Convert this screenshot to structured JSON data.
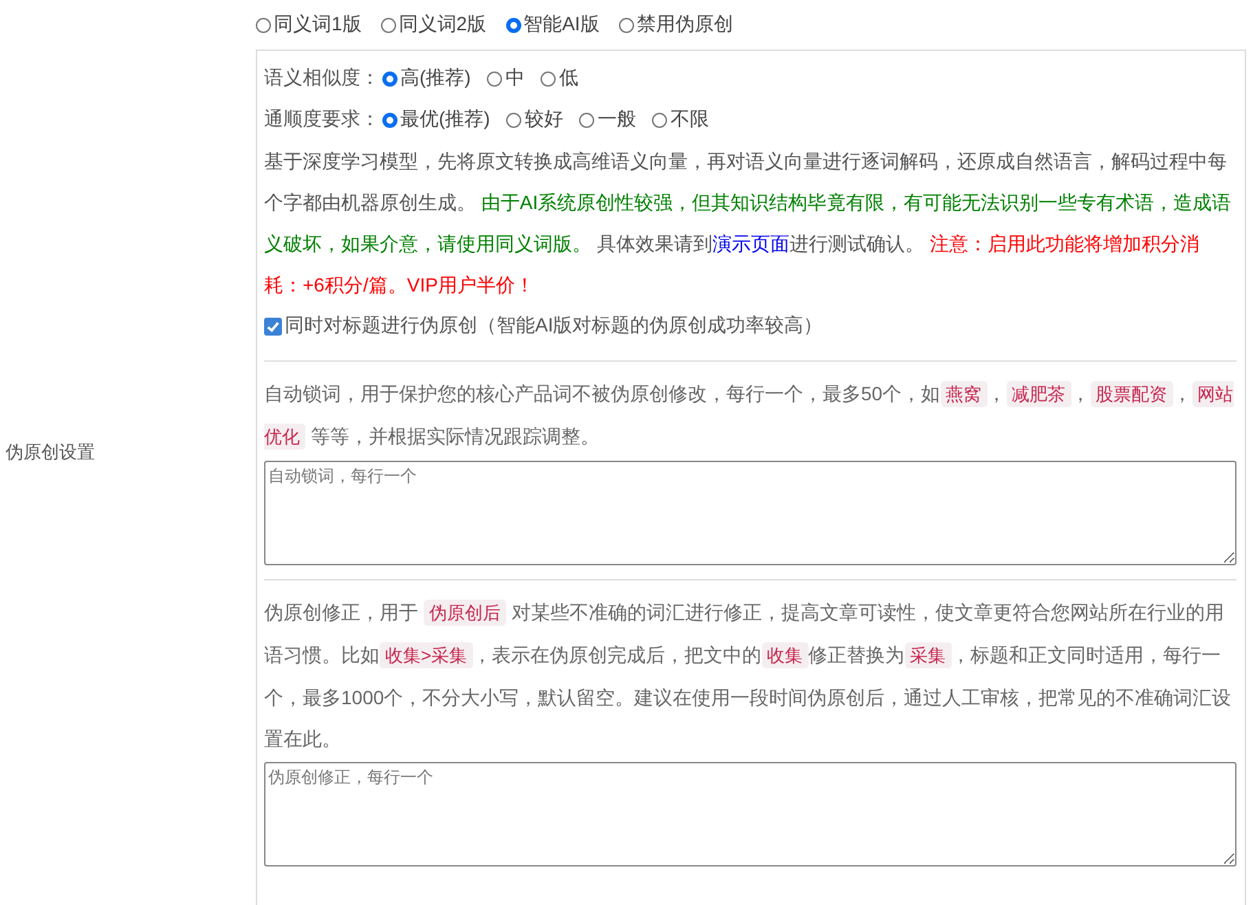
{
  "sidebar_label": "伪原创设置",
  "modes": [
    {
      "label": "同义词1版",
      "selected": false
    },
    {
      "label": "同义词2版",
      "selected": false
    },
    {
      "label": "智能AI版",
      "selected": true
    },
    {
      "label": "禁用伪原创",
      "selected": false
    }
  ],
  "similarity": {
    "label": "语义相似度：",
    "options": [
      {
        "label": "高(推荐)",
        "selected": true
      },
      {
        "label": "中",
        "selected": false
      },
      {
        "label": "低",
        "selected": false
      }
    ]
  },
  "fluency": {
    "label": "通顺度要求：",
    "options": [
      {
        "label": "最优(推荐)",
        "selected": true
      },
      {
        "label": "较好",
        "selected": false
      },
      {
        "label": "一般",
        "selected": false
      },
      {
        "label": "不限",
        "selected": false
      }
    ]
  },
  "description": [
    {
      "kind": "text",
      "text": "基于深度学习模型，先将原文转换成高维语义向量，再对语义向量进行逐词解码，还原成自然语言，解码过程中每个字都由机器原创生成。 "
    },
    {
      "kind": "caution",
      "text": "由于AI系统原创性较强，但其知识结构毕竟有限，有可能无法识别一些专有术语，造成语义破坏，如果介意，请使用同义词版。"
    },
    {
      "kind": "text",
      "text": " 具体效果请到"
    },
    {
      "kind": "link",
      "text": "演示页面"
    },
    {
      "kind": "text",
      "text": "进行测试确认。 "
    },
    {
      "kind": "notice",
      "text": "注意：启用此功能将增加积分消耗：+6积分/篇。VIP用户半价！"
    }
  ],
  "title_option": {
    "label": "同时对标题进行伪原创（智能AI版对标题的伪原创成功率较高）",
    "checked": true
  },
  "lock_words": {
    "description": [
      {
        "kind": "text",
        "text": "自动锁词，用于保护您的核心产品词不被伪原创修改，每行一个，最多50个，如"
      },
      {
        "kind": "tag",
        "text": "燕窝"
      },
      {
        "kind": "text",
        "text": "，"
      },
      {
        "kind": "tag",
        "text": "减肥茶"
      },
      {
        "kind": "text",
        "text": "，"
      },
      {
        "kind": "tag",
        "text": "股票配资"
      },
      {
        "kind": "text",
        "text": "，"
      },
      {
        "kind": "tag",
        "text": "网站优化"
      },
      {
        "kind": "text",
        "text": " 等等，并根据实际情况跟踪调整。"
      }
    ],
    "placeholder": "自动锁词，每行一个"
  },
  "correction": {
    "description": [
      {
        "kind": "text",
        "text": "伪原创修正，用于 "
      },
      {
        "kind": "tag",
        "text": "伪原创后"
      },
      {
        "kind": "text",
        "text": " 对某些不准确的词汇进行修正，提高文章可读性，使文章更符合您网站所在行业的用语习惯。比如"
      },
      {
        "kind": "tag",
        "text": "收集>采集"
      },
      {
        "kind": "text",
        "text": "，表示在伪原创完成后，把文中的"
      },
      {
        "kind": "tag",
        "text": "收集"
      },
      {
        "kind": "text",
        "text": "修正替换为"
      },
      {
        "kind": "tag",
        "text": "采集"
      },
      {
        "kind": "text",
        "text": "，标题和正文同时适用，每行一个，最多1000个，不分大小写，默认留空。建议在使用一段时间伪原创后，通过人工审核，把常见的不准确词汇设置在此。"
      }
    ],
    "placeholder": "伪原创修正，每行一个"
  }
}
